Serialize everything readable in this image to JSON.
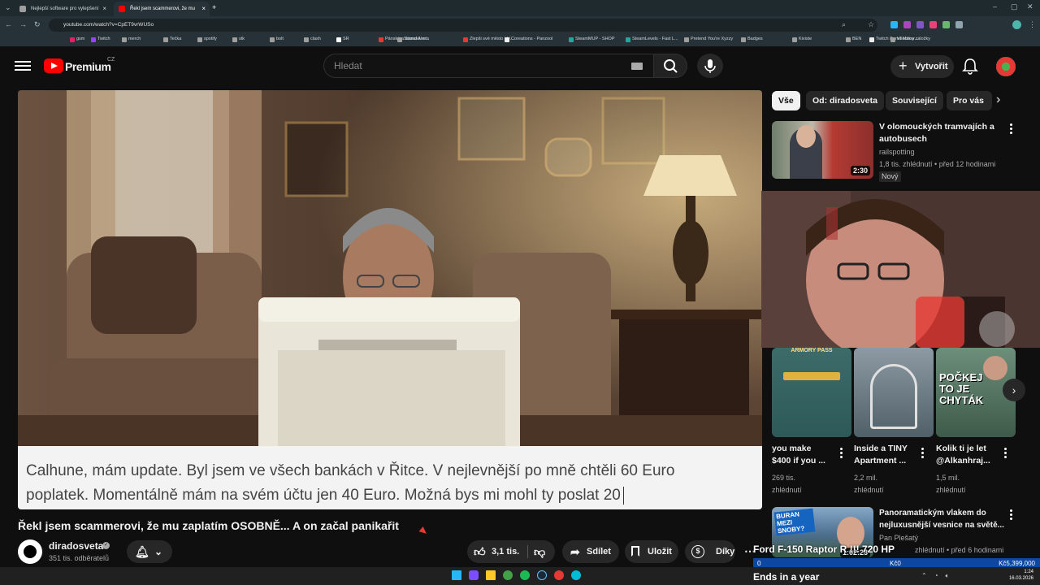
{
  "browser": {
    "tabs": [
      {
        "title": "Nejlepší software pro vylepšení",
        "color": "#9e9e9e"
      },
      {
        "title": "Řekl jsem scammerovi, že mu",
        "color": "#ff0000"
      }
    ],
    "url": "youtube.com/watch?v=CpET9vrWUSo",
    "bookmarks": [
      {
        "label": "gsm",
        "color": "#e91e63"
      },
      {
        "label": "Twitch",
        "color": "#9146ff"
      },
      {
        "label": "merch",
        "color": "#9e9e9e"
      },
      {
        "label": "Tečka",
        "color": "#9e9e9e"
      },
      {
        "label": "spotify",
        "color": "#9e9e9e"
      },
      {
        "label": "stk",
        "color": "#9e9e9e"
      },
      {
        "label": "bolt",
        "color": "#9e9e9e"
      },
      {
        "label": "clash",
        "color": "#9e9e9e"
      },
      {
        "label": "SR",
        "color": "#ffffff"
      },
      {
        "label": "Pánská a dámská m...",
        "color": "#e53935"
      },
      {
        "label": "Sound Alerts",
        "color": "#9e9e9e"
      },
      {
        "label": "Zlepši své město | U...",
        "color": "#e53935"
      },
      {
        "label": "Coreations - Panzool",
        "color": "#eeeeee"
      },
      {
        "label": "SteamMUP - SHOP",
        "color": "#26a69a"
      },
      {
        "label": "SteamLevels - Fast L...",
        "color": "#26a69a"
      },
      {
        "label": "Pretend You're Xyzzy",
        "color": "#9e9e9e"
      },
      {
        "label": "Badges",
        "color": "#9e9e9e"
      },
      {
        "label": "Kiviste",
        "color": "#9e9e9e"
      },
      {
        "label": "BEN",
        "color": "#9e9e9e"
      },
      {
        "label": "Twitch Panel Maker...",
        "color": "#eeeeee"
      },
      {
        "label": "Všechny záložky",
        "color": "#9e9e9e"
      }
    ]
  },
  "header": {
    "logo_text": "Premium",
    "logo_region": "CZ",
    "search_placeholder": "Hledat",
    "create_label": "Vytvořit"
  },
  "video": {
    "subtitle_line1": "Calhune, mám update. Byl jsem ve všech bankách v Řitce. V nejlevnější po mně chtěli 60 Euro",
    "subtitle_line2": "poplatek. Momentálně mám na svém účtu jen 40 Euro. Možná bys mi mohl ty poslat 20",
    "title": "Řekl jsem scammerovi, že mu zaplatím OSOBNĚ... A on začal panikařit",
    "channel": "diradosveta",
    "subscribers": "351 tis. odběratelů",
    "likes": "3,1 tis.",
    "share_label": "Sdílet",
    "save_label": "Uložit",
    "thanks_label": "Díky"
  },
  "sidebar": {
    "chips": [
      "Vše",
      "Od: diradosveta",
      "Související",
      "Pro vás"
    ],
    "first": {
      "title_line1": "V olomouckých tramvajích a",
      "title_line2": "autobusech",
      "channel": "railspotting",
      "views": "1,8 tis. zhlédnutí",
      "age": "před 12 hodinami",
      "badge": "Nový",
      "duration": "2:30"
    },
    "shorts": [
      {
        "title_line1": "you make",
        "title_line2": "$400 if you ...",
        "views": "269 tis.",
        "views2": "zhlédnutí",
        "thumb_text": "ARMORY PASS"
      },
      {
        "title_line1": "Inside a TINY",
        "title_line2": "Apartment ...",
        "views": "2,2 mil.",
        "views2": "zhlédnutí",
        "thumb_text": ""
      },
      {
        "title_line1": "Kolik ti je let",
        "title_line2": "@Alkanhraj...",
        "views": "1,5 mil.",
        "views2": "zhlédnutí",
        "thumb_text": "POČKEJ TO JE CHYTÁK"
      }
    ],
    "last": {
      "title_line1": "Panoramatickým vlakem do",
      "title_line2": "nejluxusnější vesnice na světě...",
      "channel": "Pan Plešatý",
      "meta": "zhlédnutí • před 6 hodinami",
      "duration": "1:02:23",
      "thumb_text": "BURAN MEZI SNOBY?"
    }
  },
  "overlay": {
    "ticker_title": "Ford F-150 Raptor R !!! 720 HP",
    "ticker_left": "0",
    "ticker_mid": "Kč0",
    "ticker_right": "Kč5,399,000",
    "ends": "Ends in a year"
  },
  "taskbar": {
    "time": "1:24",
    "date": "16.03.2026"
  }
}
